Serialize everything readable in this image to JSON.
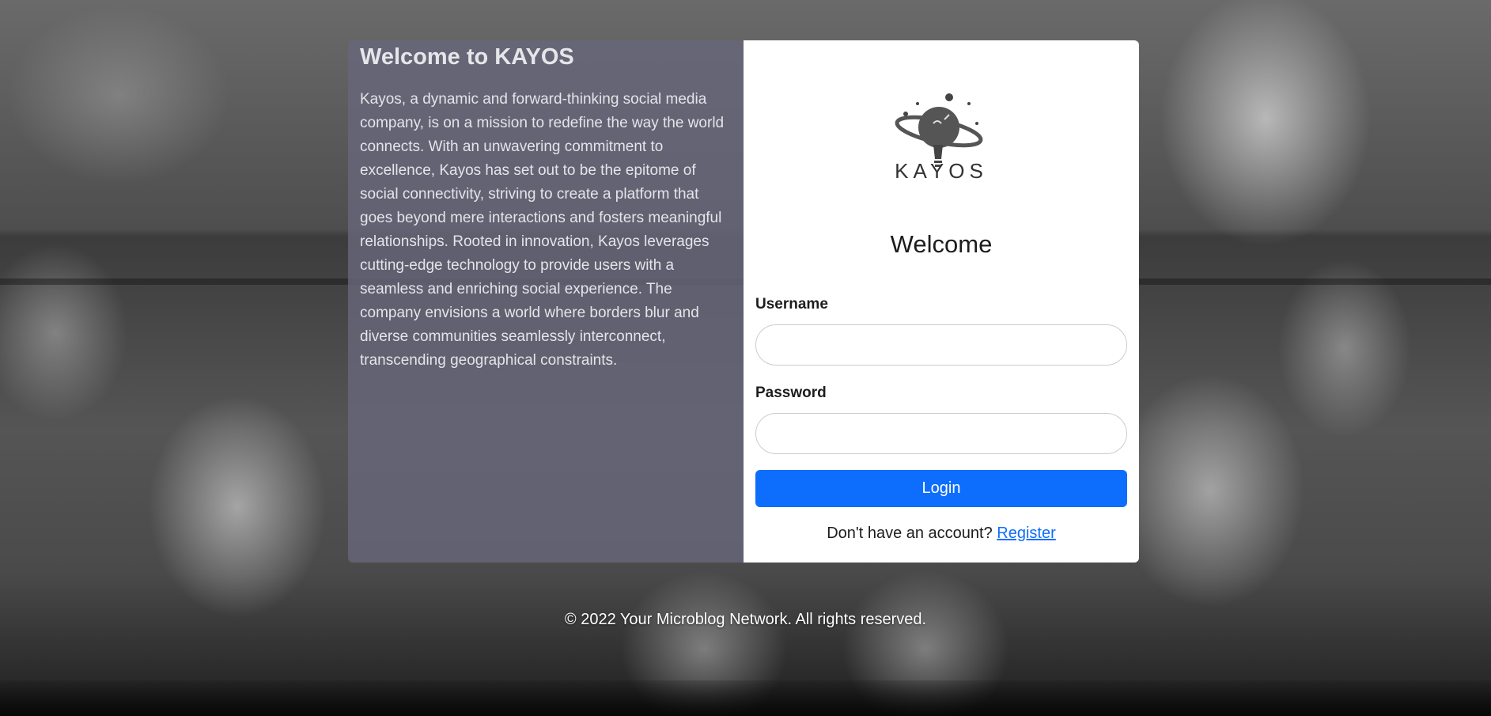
{
  "about": {
    "title": "Welcome to KAYOS",
    "text": "Kayos, a dynamic and forward-thinking social media company, is on a mission to redefine the way the world connects. With an unwavering commitment to excellence, Kayos has set out to be the epitome of social connectivity, striving to create a platform that goes beyond mere interactions and fosters meaningful relationships. Rooted in innovation, Kayos leverages cutting-edge technology to provide users with a seamless and enriching social experience. The company envisions a world where borders blur and diverse communities seamlessly interconnect, transcending geographical constraints."
  },
  "logo": {
    "icon": "planet-lightbulb-logo",
    "text": "KAYOS"
  },
  "login": {
    "heading": "Welcome",
    "username_label": "Username",
    "username_value": "",
    "password_label": "Password",
    "password_value": "",
    "button_label": "Login",
    "signup_prompt": "Don't have an account?",
    "signup_link": "Register"
  },
  "footer": {
    "text": "© 2022 Your Microblog Network. All rights reserved."
  },
  "colors": {
    "primary": "#0d6efd",
    "about_panel": "#66667a"
  }
}
